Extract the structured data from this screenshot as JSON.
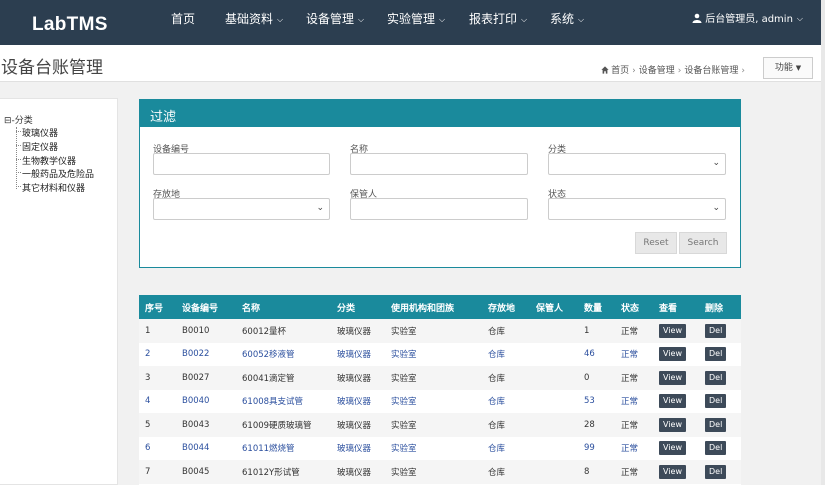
{
  "nav": {
    "brand": "LabTMS",
    "items": [
      {
        "label": "首页",
        "dropdown": false
      },
      {
        "label": "基础资料",
        "dropdown": true
      },
      {
        "label": "设备管理",
        "dropdown": true
      },
      {
        "label": "实验管理",
        "dropdown": true
      },
      {
        "label": "报表打印",
        "dropdown": true
      },
      {
        "label": "系统",
        "dropdown": true
      }
    ],
    "user": "后台管理员, admin"
  },
  "header": {
    "title": "设备台账管理",
    "breadcrumb": [
      "首页",
      "设备管理",
      "设备台账管理"
    ],
    "func_button": "功能"
  },
  "tree": {
    "root": "⊟-分类",
    "items": [
      "玻璃仪器",
      "固定仪器",
      "生物教学仪器",
      "一般药品及危险品",
      "其它材料和仪器"
    ]
  },
  "filter": {
    "title": "过滤",
    "labels": {
      "code": "设备编号",
      "name": "名称",
      "category": "分类",
      "location": "存放地",
      "keeper": "保管人",
      "status": "状态"
    },
    "reset": "Reset",
    "search": "Search"
  },
  "table": {
    "headers": [
      "序号",
      "设备编号",
      "名称",
      "分类",
      "使用机构和团族",
      "存放地",
      "保管人",
      "数量",
      "状态",
      "查看",
      "删除"
    ],
    "view_label": "View",
    "del_label": "Del",
    "rows": [
      [
        "1",
        "B0010",
        "60012量杯",
        "玻璃仪器",
        "实验室",
        "仓库",
        "",
        "1",
        "正常"
      ],
      [
        "2",
        "B0022",
        "60052移液管",
        "玻璃仪器",
        "实验室",
        "仓库",
        "",
        "46",
        "正常"
      ],
      [
        "3",
        "B0027",
        "60041滴定管",
        "玻璃仪器",
        "实验室",
        "仓库",
        "",
        "0",
        "正常"
      ],
      [
        "4",
        "B0040",
        "61008具支试管",
        "玻璃仪器",
        "实验室",
        "仓库",
        "",
        "53",
        "正常"
      ],
      [
        "5",
        "B0043",
        "61009硬质玻璃管",
        "玻璃仪器",
        "实验室",
        "仓库",
        "",
        "28",
        "正常"
      ],
      [
        "6",
        "B0044",
        "61011燃烧管",
        "玻璃仪器",
        "实验室",
        "仓库",
        "",
        "99",
        "正常"
      ],
      [
        "7",
        "B0045",
        "61012Y形试管",
        "玻璃仪器",
        "实验室",
        "仓库",
        "",
        "8",
        "正常"
      ]
    ]
  }
}
